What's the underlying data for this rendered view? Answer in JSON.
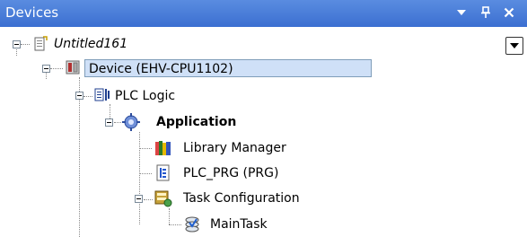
{
  "panel": {
    "title": "Devices",
    "buttons": {
      "menu": "▼",
      "pin": "ᵖ",
      "close": "✕"
    }
  },
  "tree": {
    "project": {
      "label": "Untitled161",
      "icon": "project-file-icon"
    },
    "device": {
      "label": "Device (EHV-CPU1102)",
      "icon": "device-icon",
      "selected": true
    },
    "plc_logic": {
      "label": "PLC Logic",
      "icon": "plc-logic-icon"
    },
    "application": {
      "label": "Application",
      "icon": "application-gear-icon"
    },
    "library_manager": {
      "label": "Library Manager",
      "icon": "library-books-icon"
    },
    "plc_prg": {
      "label": "PLC_PRG (PRG)",
      "icon": "program-file-icon"
    },
    "task_config": {
      "label": "Task Configuration",
      "icon": "task-configuration-icon"
    },
    "main_task": {
      "label": "MainTask",
      "icon": "task-icon"
    }
  },
  "colors": {
    "titlebar": "#3b6fd1",
    "selection": "#cfe0f7"
  }
}
